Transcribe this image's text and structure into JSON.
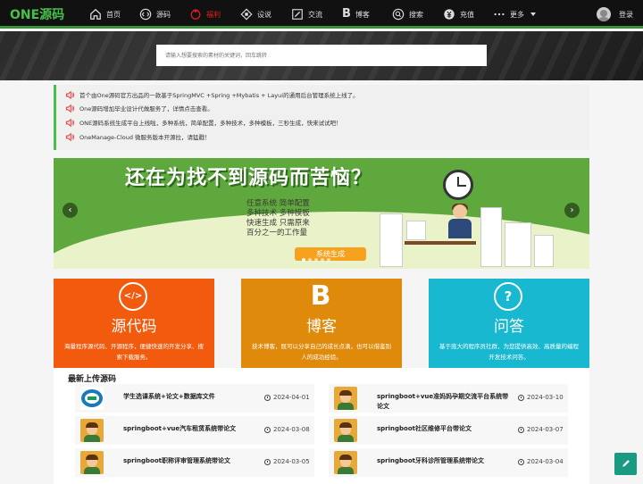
{
  "app": {
    "logo": "ONE源码"
  },
  "nav": [
    {
      "label": "首页",
      "icon": "home-icon"
    },
    {
      "label": "源码",
      "icon": "code-icon"
    },
    {
      "label": "福利",
      "icon": "gift-icon",
      "active": true
    },
    {
      "label": "设说",
      "icon": "message-icon"
    },
    {
      "label": "交流",
      "icon": "edit-icon"
    },
    {
      "label": "博客",
      "icon": "blog-b-icon"
    },
    {
      "label": "搜索",
      "icon": "search-icon"
    },
    {
      "label": "充值",
      "icon": "wallet-icon"
    },
    {
      "label": "更多",
      "icon": "more-icon"
    }
  ],
  "login": {
    "label": "登录"
  },
  "search": {
    "placeholder": "请输入想要搜索的素材的关键词，回车跳转"
  },
  "notices": [
    "首个由One源码官方出品的一款基于SpringMVC +Spring +Mybatis + Layui的通用后台管理系统上线了。",
    "One源码增加毕业设计代做服务了，详情点击查看。",
    "ONE源码系统生成平台上线啦，多种系统，简单配置，多种技术，多种模板，三秒生成，快来试试吧！",
    "OneManage-Cloud 微服务版本开源拉，请猛戳！"
  ],
  "slider": {
    "headline": "还在为找不到源码而苦恼？",
    "lines": [
      "任意系统 简单配置",
      "多种技术 多种模板",
      "快速生成 只需原来",
      "百分之一的工作量"
    ],
    "button": "系统生成",
    "prev": "‹",
    "next": "›"
  },
  "cards": [
    {
      "icon": "</>",
      "title": "源代码",
      "desc": "海量程序源代码、开源程序，便捷快速的开发分享、搜索下载服务。",
      "color": "#f25a0e"
    },
    {
      "icon": "B",
      "title": "博客",
      "desc": "技术博客，既可以分享自己的成长点滴，也可以借鉴别人的成功经验。",
      "color": "#e08a0c"
    },
    {
      "icon": "?",
      "title": "问答",
      "desc": "基于庞大的程序员社群，为您提供高效、高质量的编程开发技术问答。",
      "color": "#18b8d0"
    }
  ],
  "recent": {
    "title": "最新上传源码",
    "items": [
      {
        "name": "学生选课系统+论文+数据库文件",
        "date": "2024-04-01",
        "thumb": "logo"
      },
      {
        "name": "springboot+vue准妈妈孕期交流平台系统带论文",
        "date": "2024-03-10",
        "thumb": "avatar"
      },
      {
        "name": "springboot+vue汽车租赁系统带论文",
        "date": "2024-03-08",
        "thumb": "avatar"
      },
      {
        "name": "springboot社区维修平台带论文",
        "date": "2024-03-07",
        "thumb": "avatar"
      },
      {
        "name": "springboot职称评审管理系统带论文",
        "date": "2024-03-05",
        "thumb": "avatar"
      },
      {
        "name": "springboot牙科诊所管理系统带论文",
        "date": "2024-03-04",
        "thumb": "avatar"
      }
    ]
  },
  "fab": {
    "icon": "pencil-icon"
  }
}
